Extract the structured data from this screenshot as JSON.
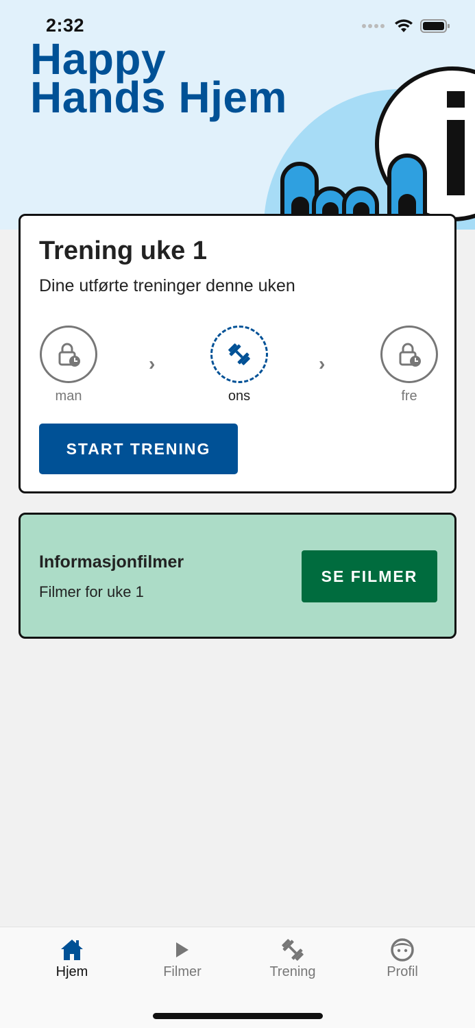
{
  "status_bar": {
    "time": "2:32"
  },
  "app": {
    "logo_line1": "Happy",
    "logo_line2": "Hands Hjem",
    "brand_color": "#005196"
  },
  "training_card": {
    "title": "Trening uke 1",
    "subtitle": "Dine utførte treninger denne uken",
    "days": [
      {
        "label": "man",
        "state": "locked",
        "icon": "lock-clock-icon"
      },
      {
        "label": "ons",
        "state": "active",
        "icon": "dumbbell-icon"
      },
      {
        "label": "fre",
        "state": "locked",
        "icon": "lock-clock-icon"
      }
    ],
    "start_button": "START TRENING"
  },
  "info_card": {
    "title": "Informasjonfilmer",
    "subtitle": "Filmer for uke 1",
    "button": "SE FILMER",
    "background": "#acdcc7",
    "button_color": "#006c3e"
  },
  "tabs": [
    {
      "label": "Hjem",
      "icon": "home-icon",
      "active": true
    },
    {
      "label": "Filmer",
      "icon": "play-icon",
      "active": false
    },
    {
      "label": "Trening",
      "icon": "dumbbell-icon",
      "active": false
    },
    {
      "label": "Profil",
      "icon": "face-icon",
      "active": false
    }
  ]
}
